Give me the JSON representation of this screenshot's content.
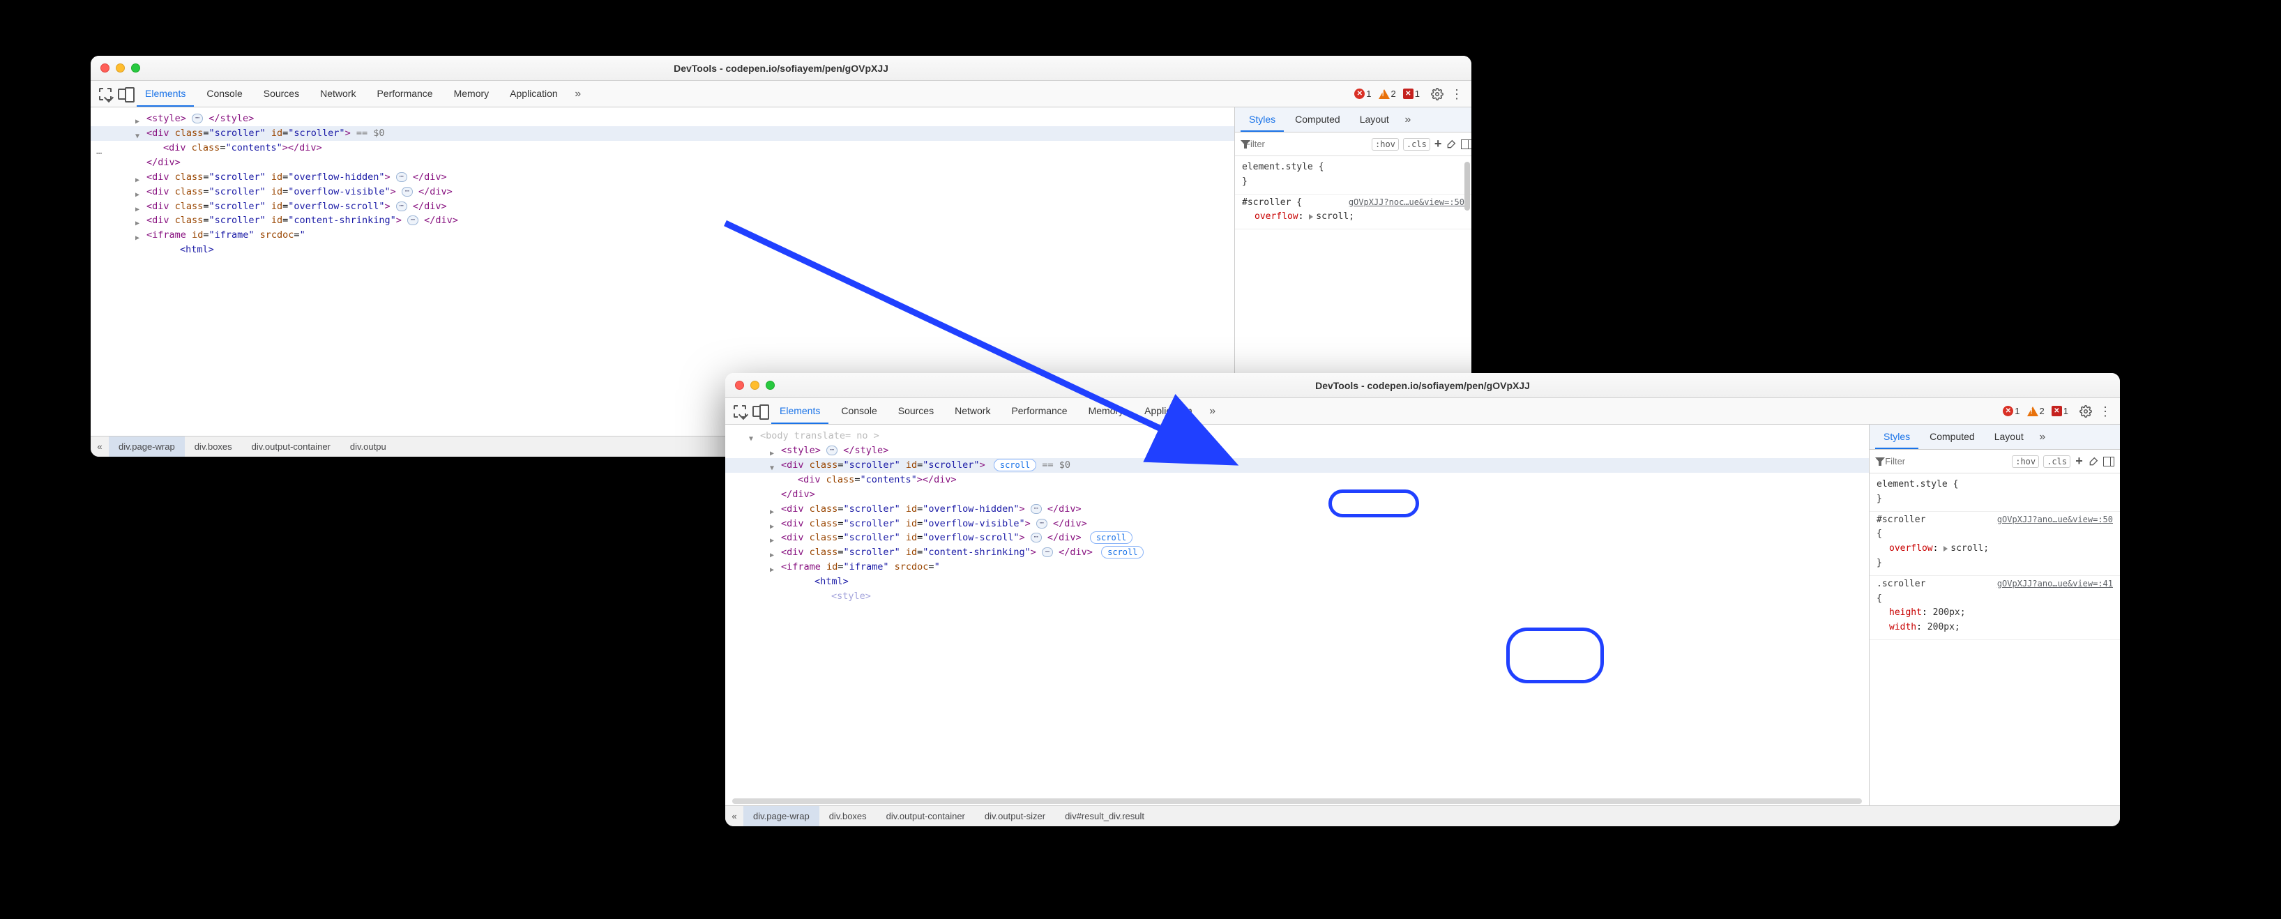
{
  "window1": {
    "title": "DevTools - codepen.io/sofiayem/pen/gOVpXJJ",
    "tabs": [
      "Elements",
      "Console",
      "Sources",
      "Network",
      "Performance",
      "Memory",
      "Application"
    ],
    "active_tab": "Elements",
    "error_count": "1",
    "warning_count": "2",
    "issue_count": "1",
    "side_tabs": [
      "Styles",
      "Computed",
      "Layout"
    ],
    "active_side_tab": "Styles",
    "filter_placeholder": "Filter",
    "hov": ":hov",
    "cls": ".cls",
    "css": {
      "el_style": "element.style {",
      "close": "}",
      "rule1_sel": "#scroller {",
      "rule1_link": "gOVpXJJ?noc…ue&view=:50",
      "rule1_prop": "overflow",
      "rule1_val": "scroll;"
    },
    "dom": {
      "l0": {
        "open": "<",
        "tag": "style",
        "close": ">",
        "end": "</style>",
        "dots": "⋯"
      },
      "l1": {
        "open": "<",
        "tag": "div",
        "a1n": "class",
        "a1v": "\"scroller\"",
        "a2n": "id",
        "a2v": "\"scroller\"",
        "close": ">",
        "eq": " == $0"
      },
      "l2": {
        "open": "<",
        "tag": "div",
        "a1n": "class",
        "a1v": "\"contents\"",
        "close": ">",
        "end": "</div>"
      },
      "l3": {
        "end": "</div>"
      },
      "l4": {
        "open": "<",
        "tag": "div",
        "a1n": "class",
        "a1v": "\"scroller\"",
        "a2n": "id",
        "a2v": "\"overflow-hidden\"",
        "close": ">",
        "end": "</div>",
        "dots": "⋯"
      },
      "l5": {
        "open": "<",
        "tag": "div",
        "a1n": "class",
        "a1v": "\"scroller\"",
        "a2n": "id",
        "a2v": "\"overflow-visible\"",
        "close": ">",
        "end": "</div>",
        "dots": "⋯"
      },
      "l6": {
        "open": "<",
        "tag": "div",
        "a1n": "class",
        "a1v": "\"scroller\"",
        "a2n": "id",
        "a2v": "\"overflow-scroll\"",
        "close": ">",
        "end": "</div>",
        "dots": "⋯"
      },
      "l7": {
        "open": "<",
        "tag": "div",
        "a1n": "class",
        "a1v": "\"scroller\"",
        "a2n": "id",
        "a2v": "\"content-shrinking\"",
        "close": ">",
        "end": "</div>",
        "dots": "⋯"
      },
      "l8": {
        "open": "<",
        "tag": "iframe",
        "a1n": "id",
        "a1v": "\"iframe\"",
        "a2n": "srcdoc",
        "a2v": "\"",
        "close": ""
      },
      "l9": {
        "txt": "<html>"
      }
    },
    "breadcrumb": [
      "div.page-wrap",
      "div.boxes",
      "div.output-container",
      "div.outpu"
    ]
  },
  "window2": {
    "title": "DevTools - codepen.io/sofiayem/pen/gOVpXJJ",
    "tabs": [
      "Elements",
      "Console",
      "Sources",
      "Network",
      "Performance",
      "Memory",
      "Application"
    ],
    "active_tab": "Elements",
    "error_count": "1",
    "warning_count": "2",
    "issue_count": "1",
    "side_tabs": [
      "Styles",
      "Computed",
      "Layout"
    ],
    "active_side_tab": "Styles",
    "filter_placeholder": "Filter",
    "hov": ":hov",
    "cls": ".cls",
    "css": {
      "el_style": "element.style {",
      "close": "}",
      "rule1_sel": "#scroller",
      "rule1_open": "{",
      "rule1_link": "gOVpXJJ?ano…ue&view=:50",
      "rule1_prop": "overflow",
      "rule1_val": "scroll;",
      "rule2_sel": ".scroller",
      "rule2_open": "{",
      "rule2_link": "gOVpXJJ?ano…ue&view=:41",
      "rule2_p1": "height",
      "rule2_v1": "200px;",
      "rule2_p2": "width",
      "rule2_v2": "200px;"
    },
    "bodyline": {
      "tag": "body",
      "attrn": "translate",
      "attrvraw": "no"
    },
    "dom": {
      "l0": {
        "open": "<",
        "tag": "style",
        "close": ">",
        "end": "</style>",
        "dots": "⋯"
      },
      "l1": {
        "open": "<",
        "tag": "div",
        "a1n": "class",
        "a1v": "\"scroller\"",
        "a2n": "id",
        "a2v": "\"scroller\"",
        "close": ">",
        "eq": " == $0",
        "pill": "scroll"
      },
      "l2": {
        "open": "<",
        "tag": "div",
        "a1n": "class",
        "a1v": "\"contents\"",
        "close": ">",
        "end": "</div>"
      },
      "l3": {
        "end": "</div>"
      },
      "l4": {
        "open": "<",
        "tag": "div",
        "a1n": "class",
        "a1v": "\"scroller\"",
        "a2n": "id",
        "a2v": "\"overflow-hidden\"",
        "close": ">",
        "end": "</div>",
        "dots": "⋯"
      },
      "l5": {
        "open": "<",
        "tag": "div",
        "a1n": "class",
        "a1v": "\"scroller\"",
        "a2n": "id",
        "a2v": "\"overflow-visible\"",
        "close": ">",
        "end": "</div>",
        "dots": "⋯"
      },
      "l6": {
        "open": "<",
        "tag": "div",
        "a1n": "class",
        "a1v": "\"scroller\"",
        "a2n": "id",
        "a2v": "\"overflow-scroll\"",
        "close": ">",
        "end": "</div>",
        "dots": "⋯",
        "pill": "scroll"
      },
      "l7": {
        "open": "<",
        "tag": "div",
        "a1n": "class",
        "a1v": "\"scroller\"",
        "a2n": "id",
        "a2v": "\"content-shrinking\"",
        "close": ">",
        "end": "</div>",
        "dots": "⋯",
        "pill": "scroll"
      },
      "l8": {
        "open": "<",
        "tag": "iframe",
        "a1n": "id",
        "a1v": "\"iframe\"",
        "a2n": "srcdoc",
        "a2v": "\"",
        "close": ""
      },
      "l9": {
        "txt": "<html>"
      },
      "l10": {
        "txt": "<style>"
      }
    },
    "breadcrumb": [
      "div.page-wrap",
      "div.boxes",
      "div.output-container",
      "div.output-sizer",
      "div#result_div.result"
    ]
  }
}
